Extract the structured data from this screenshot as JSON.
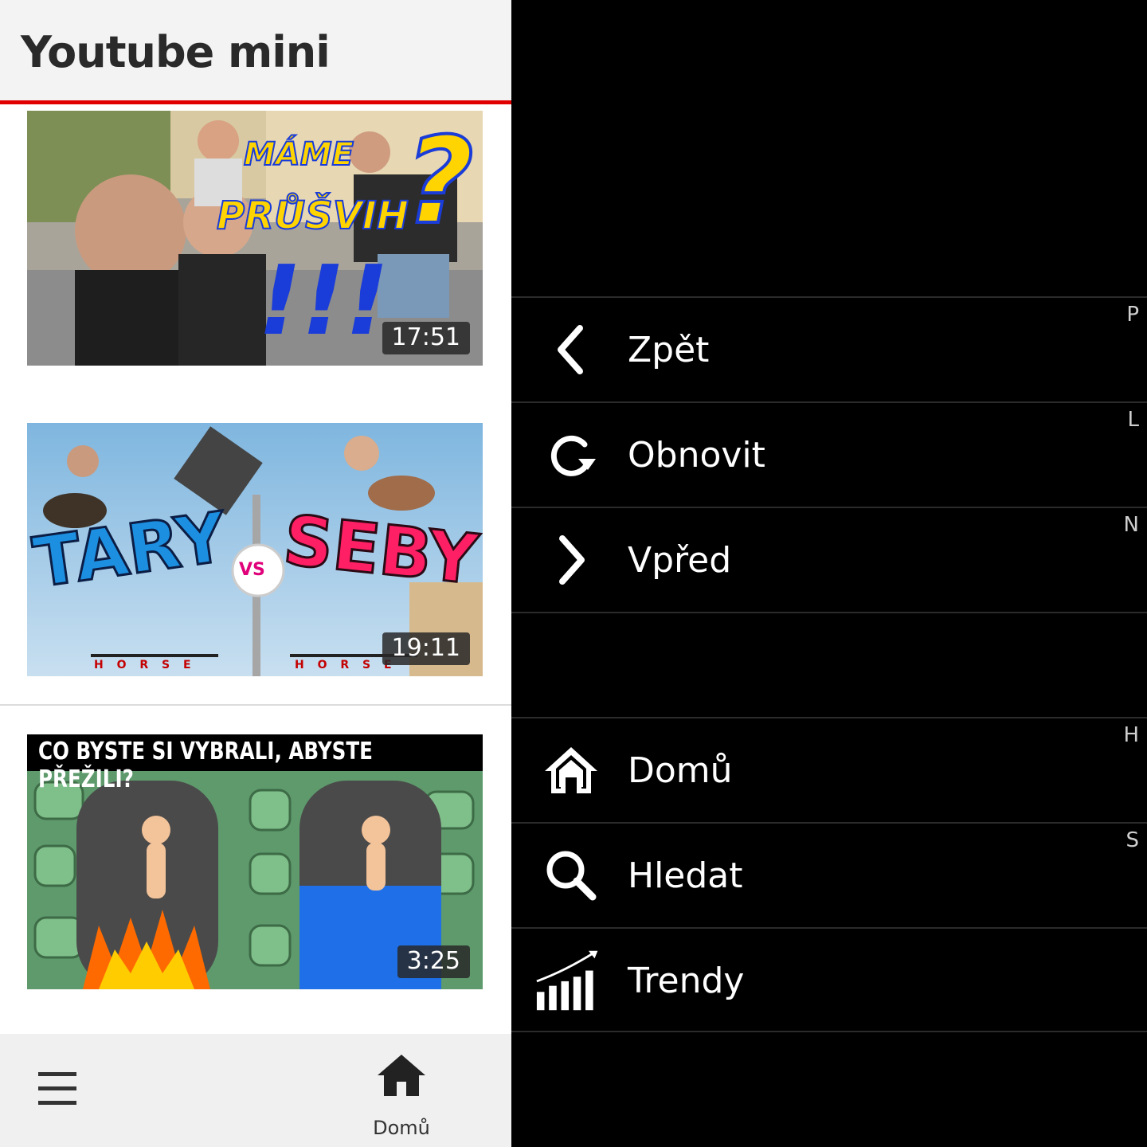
{
  "app": {
    "title": "Youtube mini"
  },
  "videos": [
    {
      "duration": "17:51",
      "overlay_text": [
        "MÁME",
        "PRŮŠVIH",
        "?",
        "!!!"
      ]
    },
    {
      "duration": "19:11",
      "overlay_text": [
        "TARY",
        "VS",
        "SEBY",
        "H O R S E",
        "H O R S E"
      ]
    },
    {
      "duration": "3:25",
      "overlay_text": [
        "CO BYSTE SI VYBRALI, ABYSTE PŘEŽILI?"
      ]
    }
  ],
  "bottom_bar": {
    "menu_icon": "hamburger-icon",
    "home_icon": "home-icon",
    "home_label": "Domů"
  },
  "menu": {
    "items": [
      {
        "label": "Zpět",
        "key": "P",
        "icon": "chevron-left-icon"
      },
      {
        "label": "Obnovit",
        "key": "L",
        "icon": "refresh-icon"
      },
      {
        "label": "Vpřed",
        "key": "N",
        "icon": "chevron-right-icon"
      },
      {
        "label": "Domů",
        "key": "H",
        "icon": "home-icon"
      },
      {
        "label": "Hledat",
        "key": "S",
        "icon": "search-icon"
      },
      {
        "label": "Trendy",
        "key": "",
        "icon": "trending-icon"
      }
    ]
  },
  "colors": {
    "accent": "#e00000",
    "menu_bg": "#000000",
    "header_bg": "#f3f3f3"
  }
}
